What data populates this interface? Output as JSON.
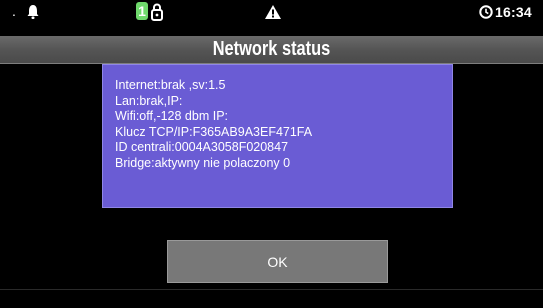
{
  "status_bar": {
    "dot": ".",
    "badge_number": "1",
    "time": "16:34",
    "icons": [
      "bell-icon",
      "lock-icon",
      "warning-icon",
      "clock-icon"
    ],
    "badge_color": "#6fd96c"
  },
  "dialog": {
    "title": "Network status",
    "info_lines": [
      "Internet:brak ,sv:1.5",
      "Lan:brak,IP:",
      "Wifi:off,-128 dbm IP:",
      "Klucz TCP/IP:F365AB9A3EF471FA",
      "ID centrali:0004A3058F020847",
      "Bridge:aktywny nie polaczony 0"
    ],
    "ok_label": "OK",
    "box_color": "#6a5cd4",
    "button_color": "#787878"
  }
}
